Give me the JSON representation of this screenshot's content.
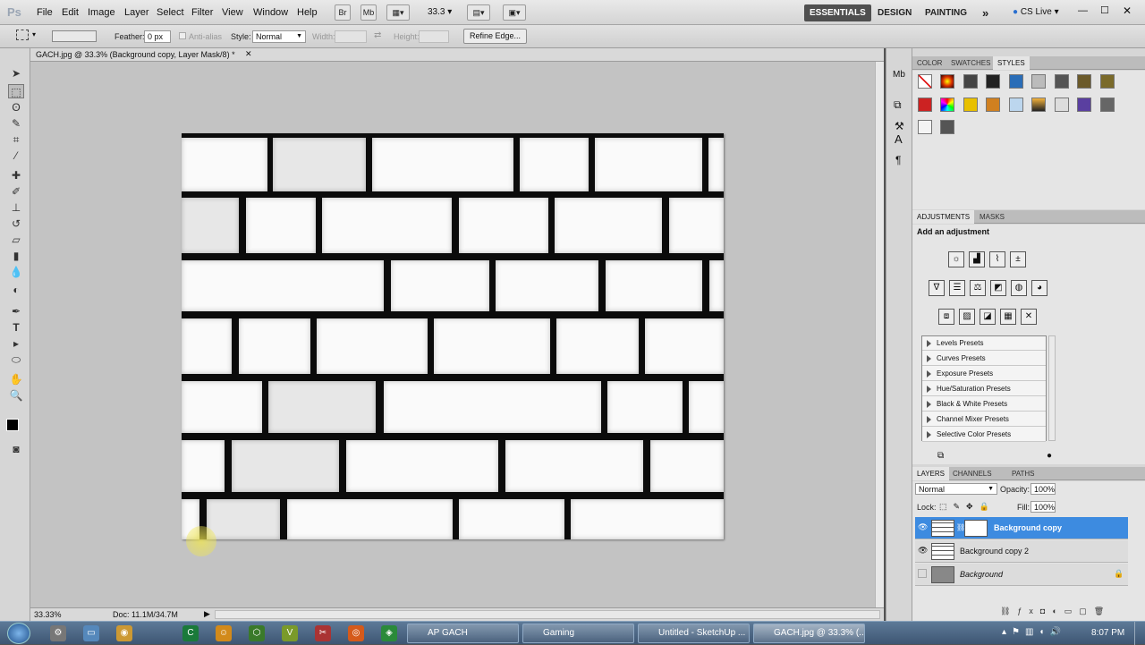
{
  "app": {
    "logo": "Ps"
  },
  "menu": {
    "items": [
      "File",
      "Edit",
      "Image",
      "Layer",
      "Select",
      "Filter",
      "View",
      "Window",
      "Help"
    ]
  },
  "appbar": {
    "bridge": "Br",
    "minibridge": "Mb",
    "zoom": "33.3",
    "workspaces": [
      "ESSENTIALS",
      "DESIGN",
      "PAINTING"
    ],
    "more": "»",
    "cslive": "CS Live"
  },
  "options": {
    "feather_label": "Feather:",
    "feather_value": "0 px",
    "antialias_label": "Anti-alias",
    "style_label": "Style:",
    "style_value": "Normal",
    "width_label": "Width:",
    "height_label": "Height:",
    "refine_edge": "Refine Edge..."
  },
  "document": {
    "tab_title": "GACH.jpg @ 33.3% (Background copy, Layer Mask/8) *",
    "zoom_status": "33.33%",
    "doc_size": "Doc: 11.1M/34.7M"
  },
  "panels": {
    "color_tabs": [
      "COLOR",
      "SWATCHES",
      "STYLES"
    ],
    "adjustments_tabs": [
      "ADJUSTMENTS",
      "MASKS"
    ],
    "adjustments_hint": "Add an adjustment",
    "presets": [
      "Levels Presets",
      "Curves Presets",
      "Exposure Presets",
      "Hue/Saturation Presets",
      "Black & White Presets",
      "Channel Mixer Presets",
      "Selective Color Presets"
    ],
    "layers_tabs": [
      "LAYERS",
      "CHANNELS",
      "PATHS"
    ],
    "blend_mode": "Normal",
    "opacity_label": "Opacity:",
    "opacity_value": "100%",
    "lock_label": "Lock:",
    "fill_label": "Fill:",
    "fill_value": "100%",
    "layers": [
      {
        "name": "Background copy",
        "selected": true
      },
      {
        "name": "Background copy 2",
        "selected": false
      },
      {
        "name": "Background",
        "selected": false
      }
    ]
  },
  "taskbar": {
    "tasks": [
      "AP GACH",
      "Gaming",
      "Untitled - SketchUp ...",
      "GACH.jpg @ 33.3% (..."
    ],
    "clock": "8:07 PM"
  },
  "colors": {
    "accent": "#3d8be0",
    "workspace_bg": "#c3c3c3"
  }
}
